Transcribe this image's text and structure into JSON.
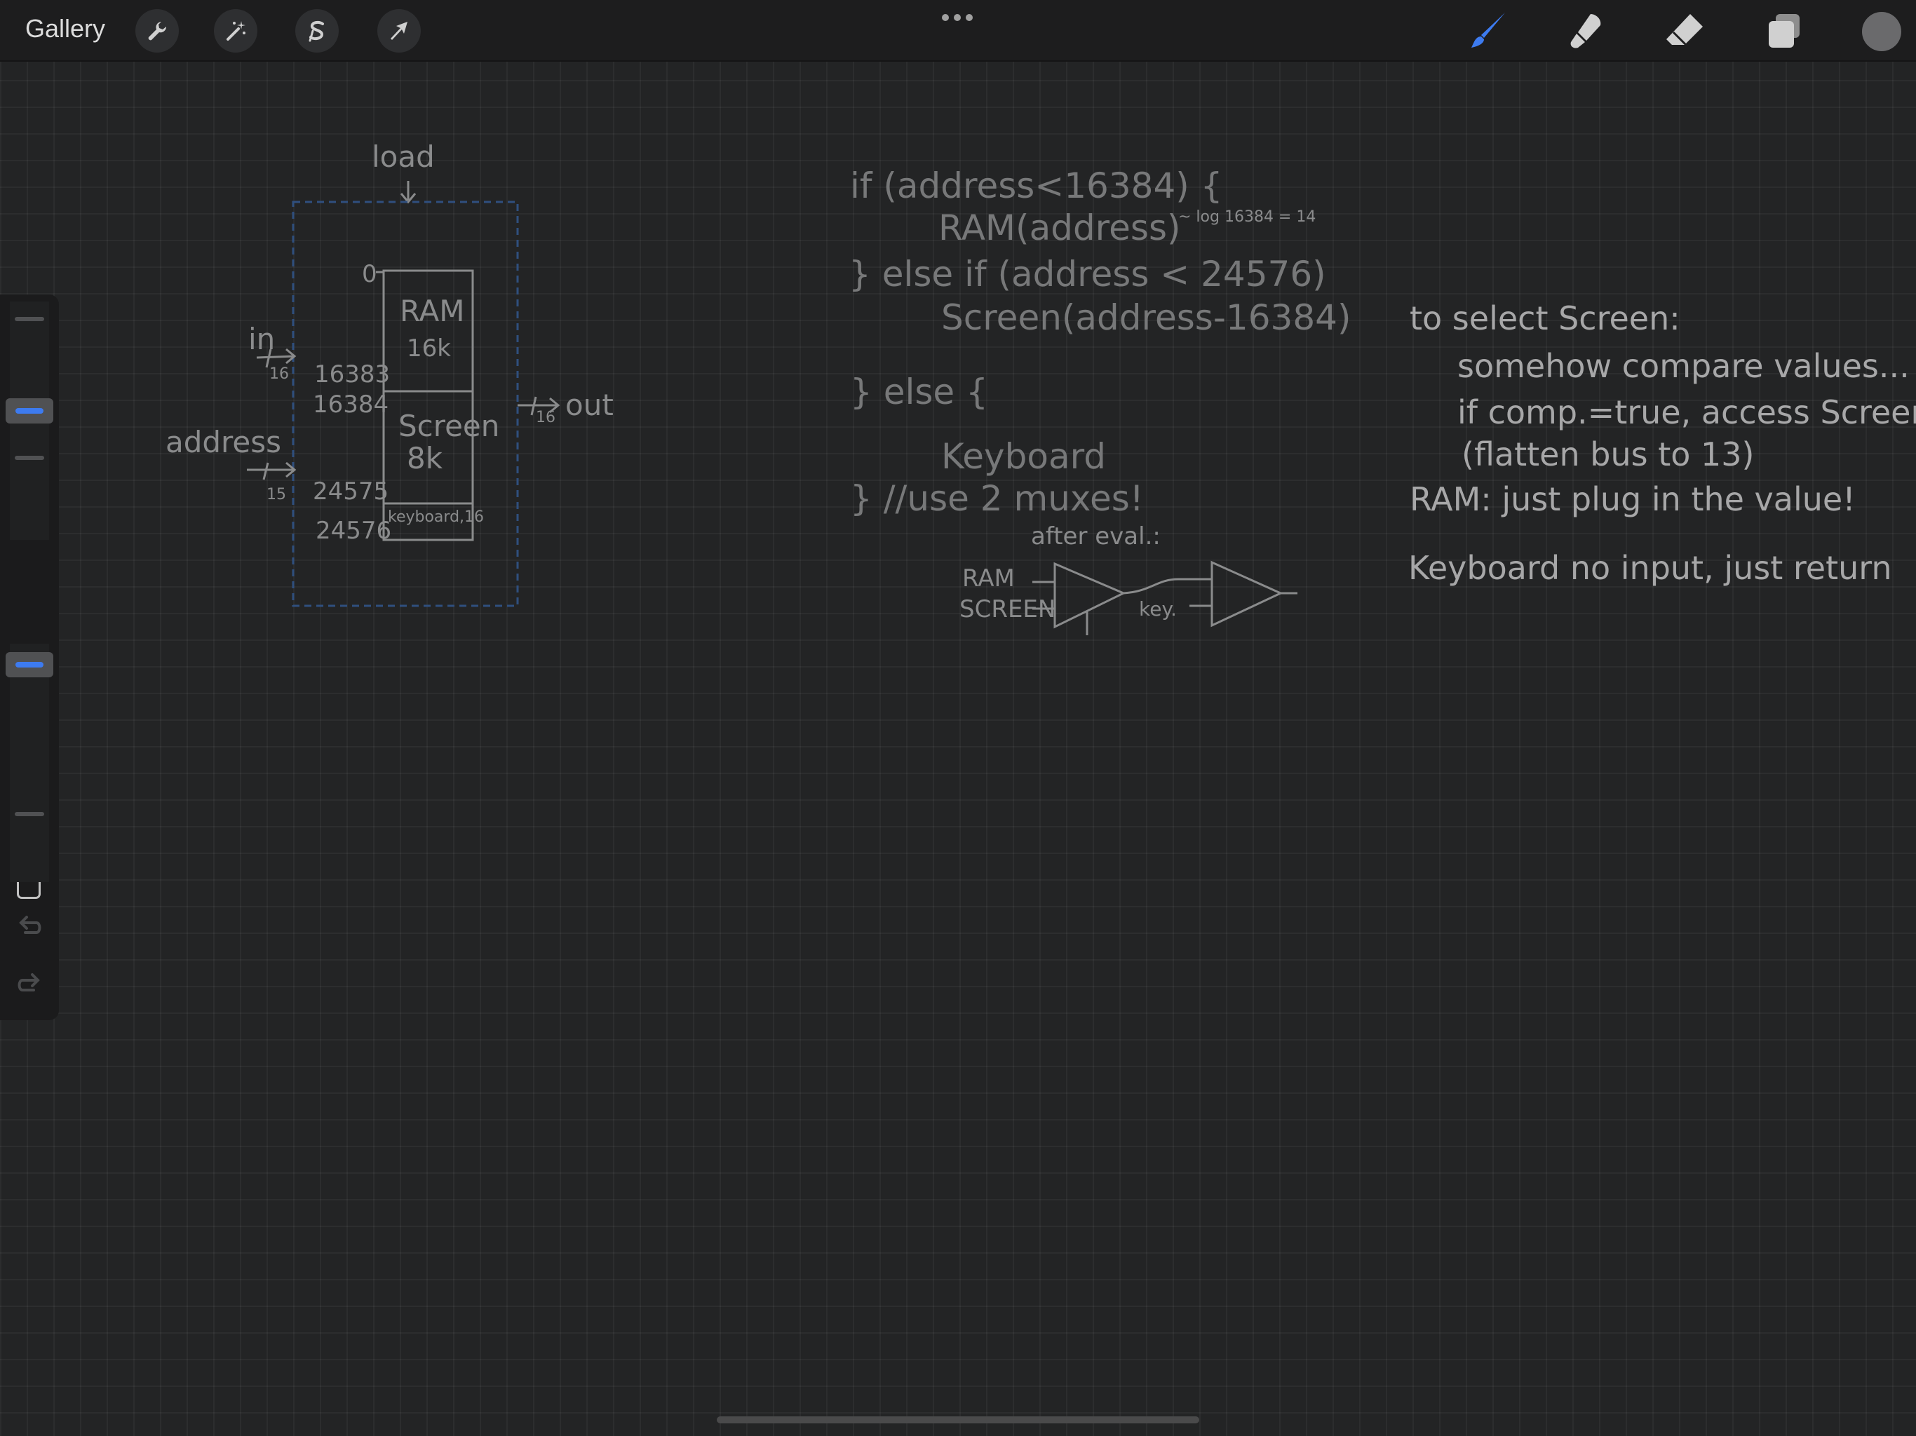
{
  "toolbar": {
    "gallery_label": "Gallery",
    "left_tools": [
      "wrench-icon",
      "magic-wand-icon",
      "selection-s-icon",
      "transform-arrow-icon"
    ],
    "more_label": "•••",
    "right_tools": [
      "brush-icon",
      "smudge-icon",
      "eraser-icon",
      "layers-icon"
    ],
    "active_tool": "brush",
    "accent_color": "#3d7bf0",
    "current_color": "#6a6a6c"
  },
  "sidebar": {
    "size_slider": {
      "level": 0.55
    },
    "opacity_slider": {
      "level": 1.0
    },
    "modify_button_icon": "square-icon",
    "undo_icon": "undo-icon",
    "redo_icon": "redo-icon"
  },
  "canvas": {
    "diagram": {
      "load_label": "load",
      "top_index": "0",
      "ram_label": "RAM",
      "ram_size": "16k",
      "in_label": "in",
      "in_width": "16",
      "idx_16383": "16383",
      "idx_16384": "16384",
      "screen_label": "Screen",
      "screen_size": "8k",
      "address_label": "address",
      "address_width": "15",
      "idx_24575": "24575",
      "idx_24576": "24576",
      "keyboard_label": "keyboard,16",
      "out_label": "out",
      "out_width": "16"
    },
    "code": {
      "line1": "if  (address<16384) {",
      "line2": "RAM(address)",
      "log_note": "~ log 16384 = 14",
      "line3": "} else if  (address < 24576)",
      "line4": "Screen(address-16384)",
      "line5": "} else {",
      "line6": "Keyboard",
      "line7": "} //use 2 muxes!"
    },
    "mux": {
      "after_eval": "after eval.:",
      "ram_input": "RAM",
      "screen_input": "SCREEN",
      "key_input": "key."
    },
    "notes": {
      "line1": "to select Screen:",
      "line2": "somehow compare values...",
      "line3": "if comp.=true, access Screen",
      "line4": "(flatten bus to 13)",
      "line5": "RAM: just plug in the value!",
      "line6": "Keyboard no input, just return"
    }
  }
}
